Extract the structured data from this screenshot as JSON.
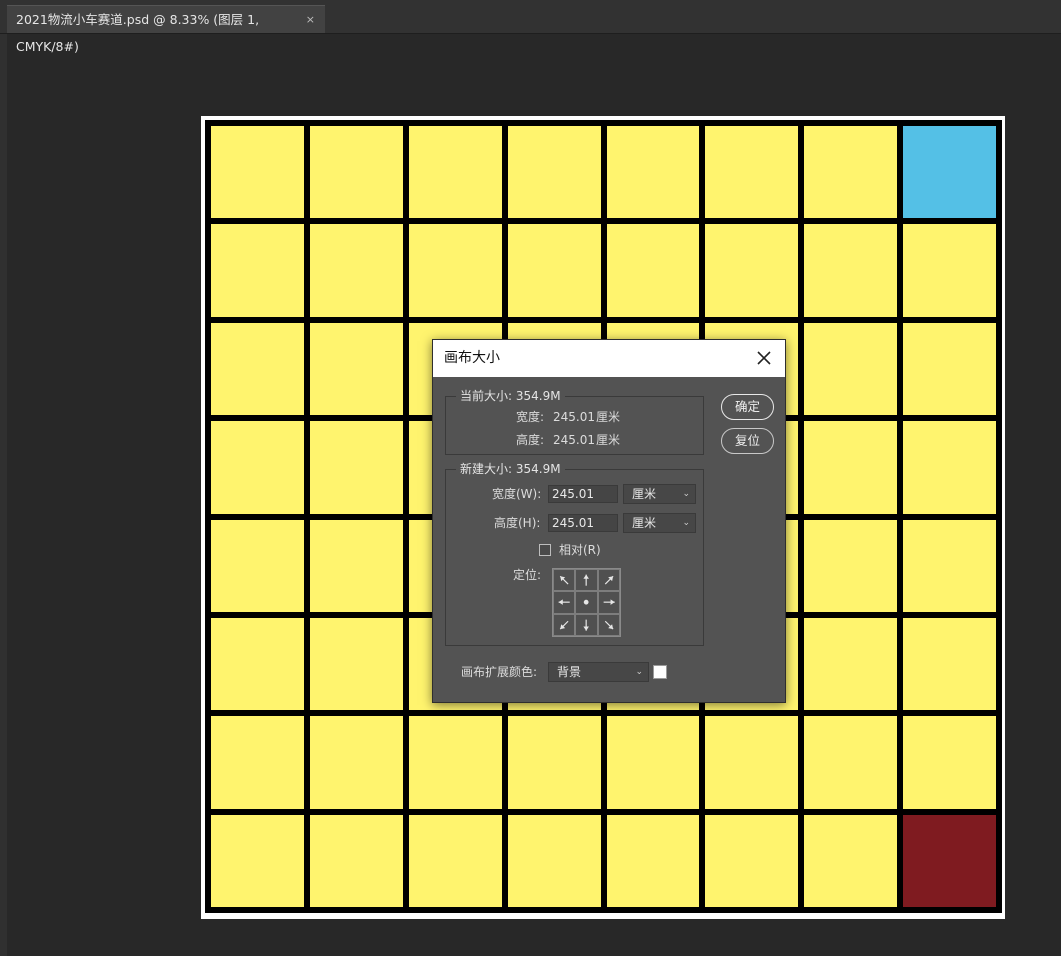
{
  "tab": {
    "title": "2021物流小车赛道.psd @ 8.33% (图层 1, CMYK/8#)",
    "close": "×"
  },
  "colors": {
    "cell_yellow": "#fff46e",
    "cell_blue": "#54c0e6",
    "cell_red": "#7f1b20",
    "grid_line": "#000000"
  },
  "board": {
    "rows": 8,
    "cols": 8,
    "blue_cell": [
      0,
      7
    ],
    "red_cell": [
      7,
      7
    ]
  },
  "dialog": {
    "title": "画布大小",
    "current": {
      "legend": "当前大小: 354.9M",
      "width_label": "宽度:",
      "width_value": "245.01",
      "width_unit": "厘米",
      "height_label": "高度:",
      "height_value": "245.01",
      "height_unit": "厘米"
    },
    "new": {
      "legend": "新建大小: 354.9M",
      "width_label": "宽度(W):",
      "width_value": "245.01",
      "width_unit": "厘米",
      "height_label": "高度(H):",
      "height_value": "245.01",
      "height_unit": "厘米",
      "relative_label": "相对(R)",
      "relative_checked": false,
      "anchor_label": "定位:"
    },
    "ext_color_label": "画布扩展颜色:",
    "ext_color_value": "背景",
    "ok_button": "确定",
    "reset_button": "复位"
  }
}
